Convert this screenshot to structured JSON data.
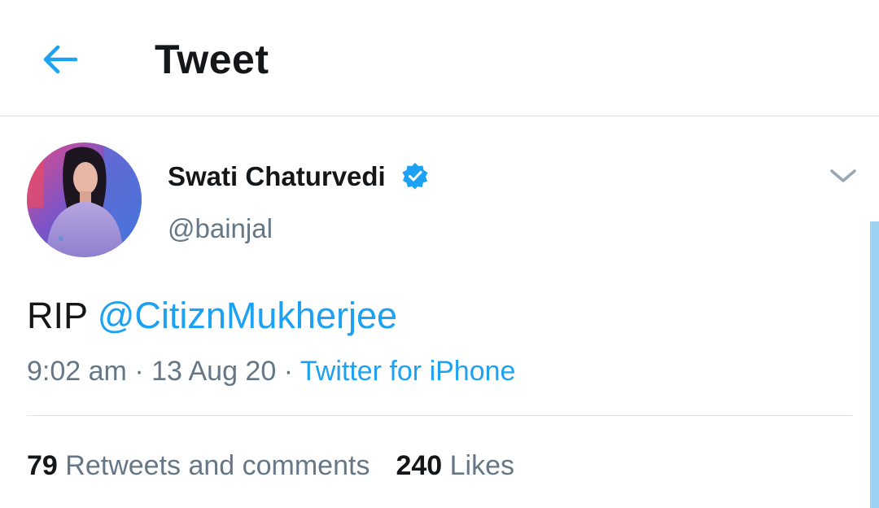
{
  "header": {
    "title": "Tweet",
    "back_icon": "arrow-left-icon",
    "accent_color": "#1da1f2"
  },
  "tweet": {
    "author_name": "Swati Chaturvedi",
    "verified": true,
    "handle": "@bainjal",
    "text_prefix": "RIP",
    "mention": "@CitiznMukherjee",
    "time": "9:02 am",
    "separator": "·",
    "date": "13 Aug 20",
    "source": "Twitter for iPhone"
  },
  "stats": {
    "retweets_count": "79",
    "retweets_label": "Retweets and comments",
    "likes_count": "240",
    "likes_label": "Likes"
  }
}
